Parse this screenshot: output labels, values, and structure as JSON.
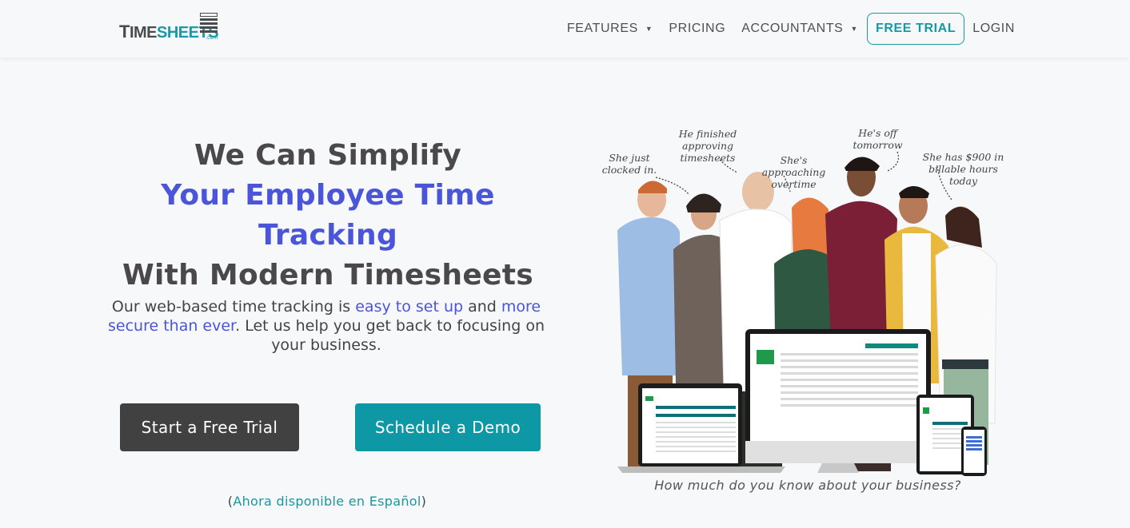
{
  "header": {
    "logo": {
      "part1_initial": "T",
      "part1_rest": "IME",
      "part2": "SHEETS",
      "suffix": ".com"
    },
    "nav": [
      {
        "label": "FEATURES",
        "has_dropdown": true
      },
      {
        "label": "PRICING",
        "has_dropdown": false
      },
      {
        "label": "ACCOUNTANTS",
        "has_dropdown": true
      },
      {
        "label": "FREE TRIAL",
        "has_dropdown": false
      },
      {
        "label": "LOGIN",
        "has_dropdown": false
      }
    ]
  },
  "hero": {
    "title_line1": "We Can Simplify",
    "title_line2": "Your Employee Time Tracking",
    "title_line3": "With Modern Timesheets",
    "subtitle": {
      "part1": "Our web-based time tracking is ",
      "highlight1": "easy to set up",
      "part2": " and ",
      "highlight2": "more secure than ever",
      "part3": ". Let us help you get back to focusing on your business."
    },
    "primary_button": "Start a Free Trial",
    "secondary_button": "Schedule a Demo",
    "spanish_open": "(",
    "spanish_link": "Ahora disponible en Español",
    "spanish_close": ")"
  },
  "image": {
    "annotations": [
      "She just\nclocked in.",
      "He finished\napproving timesheets",
      "She's approaching\novertime",
      "He's off\ntomorrow",
      "She has $900 in\nbillable hours today"
    ],
    "caption": "How much do you know about your business?"
  },
  "colors": {
    "accent_blue": "#4a55d9",
    "brand_teal": "#0e97a5",
    "dark_button": "#414141",
    "background": "#f7f8fa"
  }
}
